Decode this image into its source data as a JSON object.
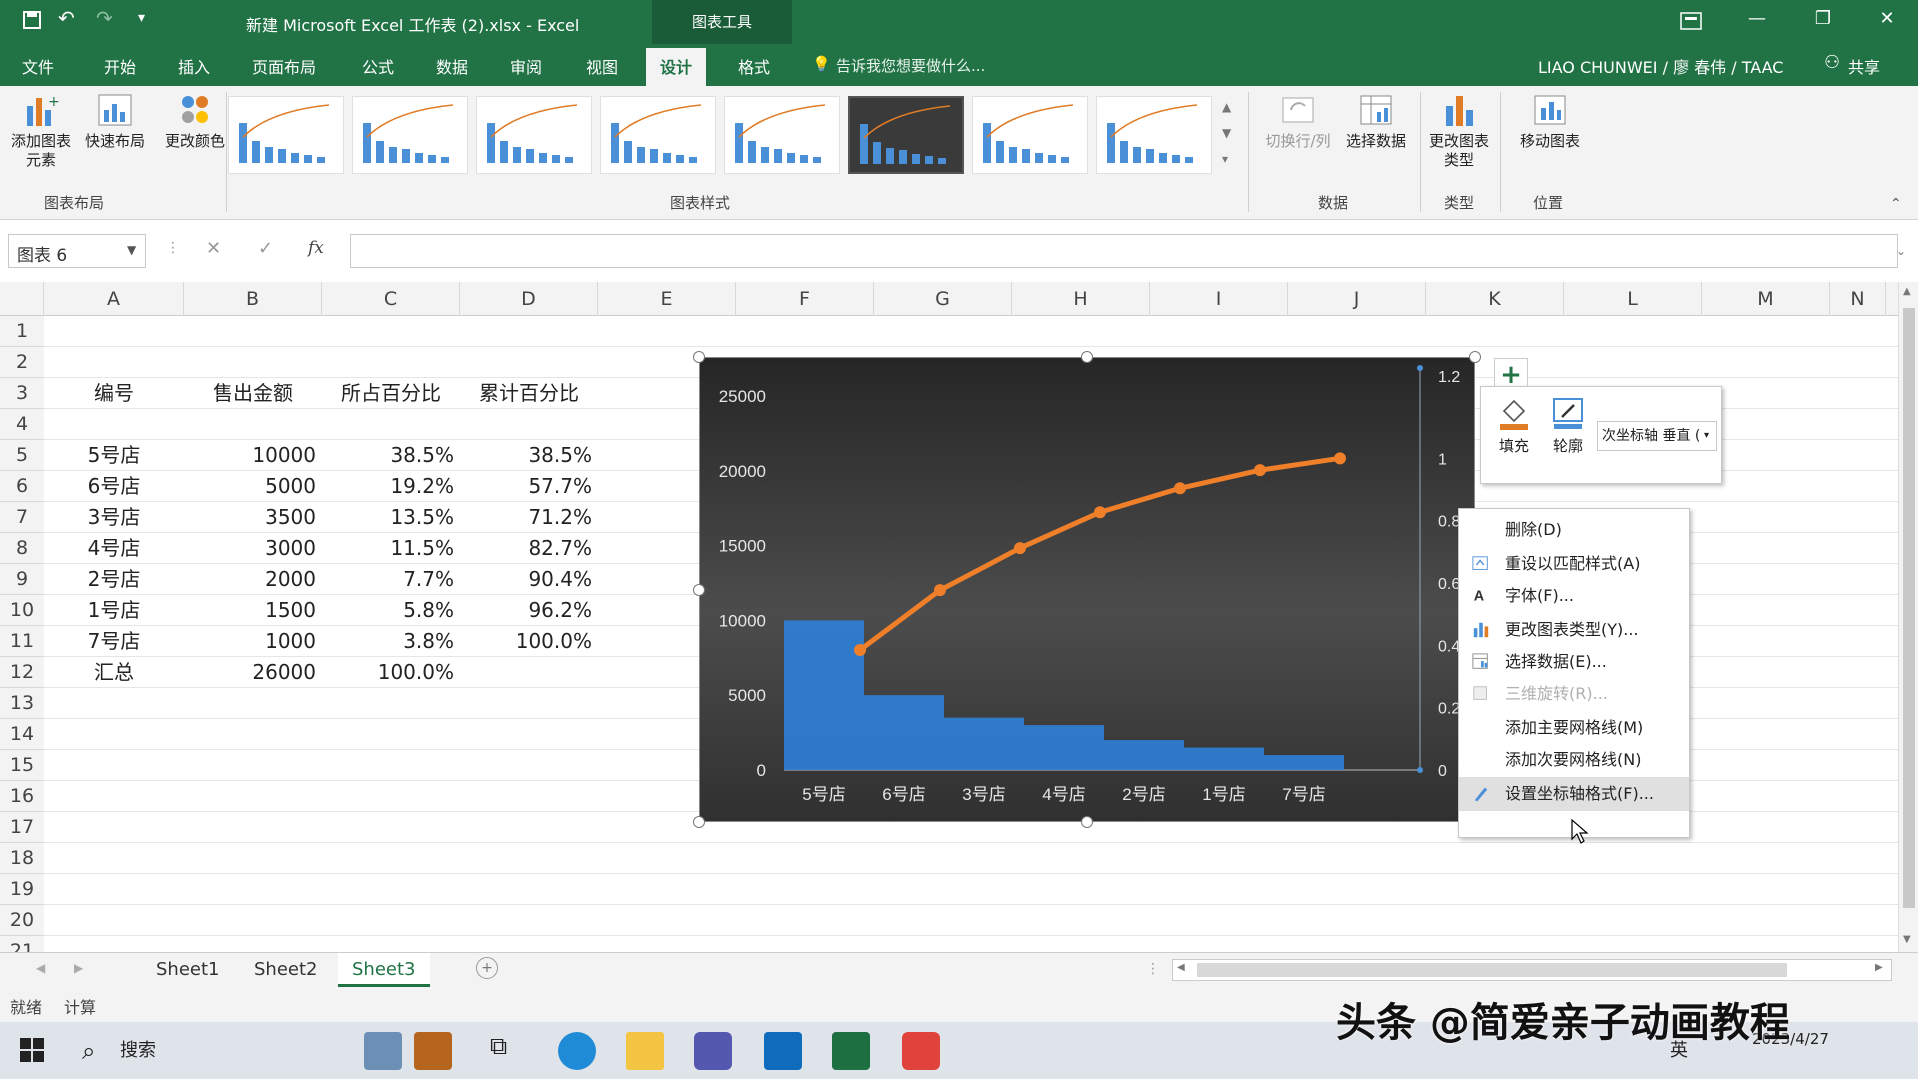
{
  "window": {
    "title": "新建 Microsoft Excel 工作表 (2).xlsx - Excel",
    "context_tool": "图表工具",
    "restore_icon": "restore-icon",
    "min": "—",
    "max": "❐",
    "close": "✕"
  },
  "tabs": [
    "文件",
    "开始",
    "插入",
    "页面布局",
    "公式",
    "数据",
    "审阅",
    "视图",
    "设计",
    "格式"
  ],
  "active_tab": "设计",
  "tell_me": "告诉我您想要做什么...",
  "user": "LIAO CHUNWEI / 廖 春伟 / TAAC",
  "share": "共享",
  "ribbon": {
    "add_element": "添加图表元素",
    "quick_layout": "快速布局",
    "change_color": "更改颜色",
    "group_layout": "图表布局",
    "group_styles": "图表样式",
    "switch_rowcol": "切换行/列",
    "select_data": "选择数据",
    "group_data": "数据",
    "change_type": "更改图表类型",
    "group_type": "类型",
    "move_chart": "移动图表",
    "group_location": "位置"
  },
  "formula": {
    "namebox": "图表 6",
    "fx": "fx",
    "cancel": "✕",
    "enter": "✓"
  },
  "columns": [
    "A",
    "B",
    "C",
    "D",
    "E",
    "F",
    "G",
    "H",
    "I",
    "J",
    "K",
    "L",
    "M",
    "N"
  ],
  "rows": [
    "1",
    "2",
    "3",
    "4",
    "5",
    "6",
    "7",
    "8",
    "9",
    "10",
    "11",
    "12",
    "13",
    "14",
    "15",
    "16",
    "17",
    "18",
    "19",
    "20",
    "21"
  ],
  "table": {
    "headers": [
      "编号",
      "售出金额",
      "所占百分比",
      "累计百分比"
    ],
    "rows": [
      [
        "5号店",
        "10000",
        "38.5%",
        "38.5%"
      ],
      [
        "6号店",
        "5000",
        "19.2%",
        "57.7%"
      ],
      [
        "3号店",
        "3500",
        "13.5%",
        "71.2%"
      ],
      [
        "4号店",
        "3000",
        "11.5%",
        "82.7%"
      ],
      [
        "2号店",
        "2000",
        "7.7%",
        "90.4%"
      ],
      [
        "1号店",
        "1500",
        "5.8%",
        "96.2%"
      ],
      [
        "7号店",
        "1000",
        "3.8%",
        "100.0%"
      ]
    ],
    "total": [
      "汇总",
      "26000",
      "100.0%"
    ]
  },
  "chart_data": {
    "type": "bar",
    "categories": [
      "5号店",
      "6号店",
      "3号店",
      "4号店",
      "2号店",
      "1号店",
      "7号店"
    ],
    "series": [
      {
        "values": [
          10000,
          5000,
          3500,
          3000,
          2000,
          1500,
          1000
        ],
        "axis": "primary",
        "kind": "bar",
        "color": "#2f7fd6"
      },
      {
        "values": [
          0.385,
          0.577,
          0.712,
          0.827,
          0.904,
          0.962,
          1.0
        ],
        "axis": "secondary",
        "kind": "line",
        "color": "#f07f2a"
      }
    ],
    "ylim": [
      0,
      25000
    ],
    "yticks": [
      "25000",
      "20000",
      "15000",
      "10000",
      "5000",
      "0"
    ],
    "y2lim": [
      0,
      1.2
    ],
    "y2ticks": [
      "1.2",
      "1",
      "0.8",
      "0.6",
      "0.4",
      "0.2",
      "0"
    ],
    "grid": false
  },
  "minibar": {
    "fill": "填充",
    "outline": "轮廓",
    "dropdown": "次坐标轴 垂直 ("
  },
  "context_menu": [
    {
      "label": "删除(D)",
      "icon": "",
      "disabled": false
    },
    {
      "label": "重设以匹配样式(A)",
      "icon": "reset-style-icon",
      "disabled": false
    },
    {
      "label": "字体(F)...",
      "icon": "font-icon",
      "disabled": false
    },
    {
      "label": "更改图表类型(Y)...",
      "icon": "chart-type-icon",
      "disabled": false
    },
    {
      "label": "选择数据(E)...",
      "icon": "select-data-icon",
      "disabled": false
    },
    {
      "label": "三维旋转(R)...",
      "icon": "rotate-3d-icon",
      "disabled": true
    },
    {
      "label": "添加主要网格线(M)",
      "icon": "",
      "disabled": false
    },
    {
      "label": "添加次要网格线(N)",
      "icon": "",
      "disabled": false
    },
    {
      "label": "设置坐标轴格式(F)...",
      "icon": "format-axis-icon",
      "disabled": false
    }
  ],
  "sheets": [
    "Sheet1",
    "Sheet2",
    "Sheet3"
  ],
  "active_sheet": "Sheet3",
  "status": {
    "ready": "就绪",
    "calc": "计算"
  },
  "taskbar": {
    "search": "搜索",
    "date": "2023/4/27",
    "ime": "英"
  },
  "watermark": "头条 @简爱亲子动画教程"
}
